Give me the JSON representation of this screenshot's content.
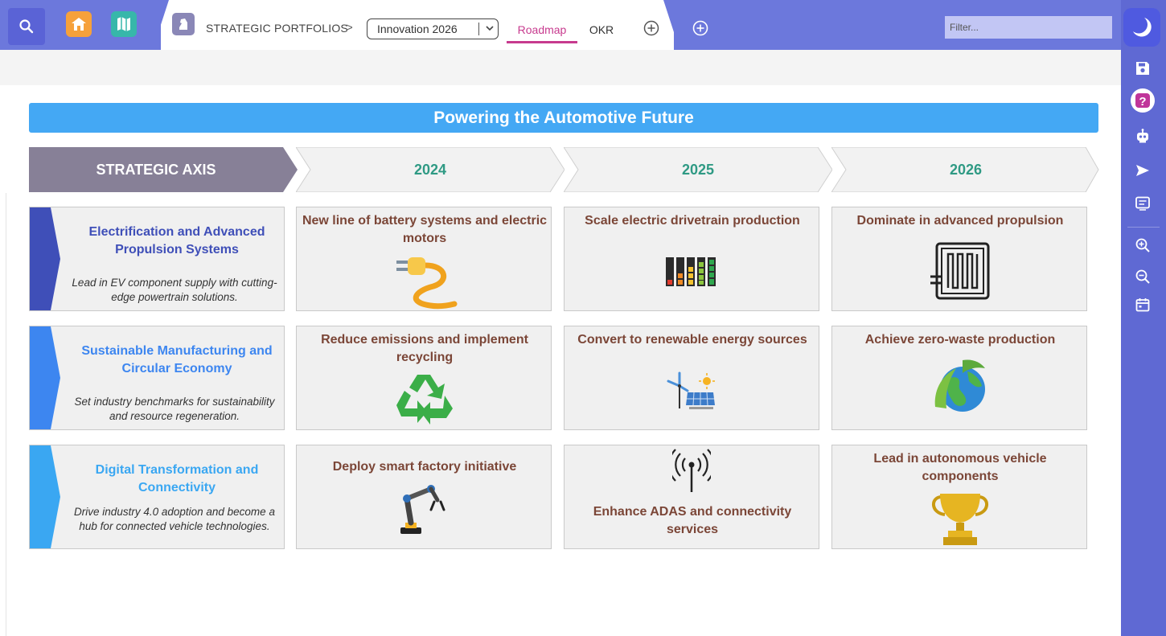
{
  "topbar": {
    "breadcrumb": "STRATEGIC PORTFOLIOS",
    "breadcrumb_separator": ">",
    "portfolio_selected": "Innovation 2026",
    "tabs": [
      {
        "label": "Roadmap",
        "active": true
      },
      {
        "label": "OKR",
        "active": false
      }
    ],
    "filter_placeholder": "Filter..."
  },
  "colors": {
    "topbar": "#6c78dc",
    "sidebar": "#5f69d3",
    "banner": "#44a8f4",
    "active_tab": "#c73a8e",
    "year_text": "#2f9a84",
    "cell_title": "#7b4637"
  },
  "roadmap": {
    "title": "Powering the Automotive Future",
    "axis_header": "STRATEGIC AXIS",
    "years": [
      "2024",
      "2025",
      "2026"
    ],
    "axes": [
      {
        "title": "Electrification and Advanced Propulsion Systems",
        "description": "Lead in EV component supply with cutting-edge powertrain solutions.",
        "color": "#3f4fb8",
        "cells": [
          {
            "title": "New line of battery systems and electric motors",
            "icon": "plug-icon"
          },
          {
            "title": "Scale electric drivetrain production",
            "icon": "battery-levels-icon"
          },
          {
            "title": "Dominate in advanced propulsion",
            "icon": "heating-coil-icon"
          }
        ]
      },
      {
        "title": "Sustainable Manufacturing and Circular Economy",
        "description": "Set industry benchmarks for sustainability and resource regeneration.",
        "color": "#3d86f0",
        "cells": [
          {
            "title": "Reduce emissions and implement recycling",
            "icon": "recycle-icon"
          },
          {
            "title": "Convert to renewable energy sources",
            "icon": "renewable-energy-icon"
          },
          {
            "title": "Achieve zero-waste production",
            "icon": "eco-globe-icon"
          }
        ]
      },
      {
        "title": "Digital Transformation and Connectivity",
        "description": "Drive industry 4.0 adoption and become a hub for connected vehicle technologies.",
        "color": "#3aa7f2",
        "cells": [
          {
            "title": "Deploy smart factory initiative",
            "icon": "robot-arm-icon"
          },
          {
            "title": "Enhance ADAS and connectivity services",
            "icon": "antenna-icon"
          },
          {
            "title": "Lead in autonomous vehicle components",
            "icon": "trophy-icon"
          }
        ]
      }
    ]
  }
}
